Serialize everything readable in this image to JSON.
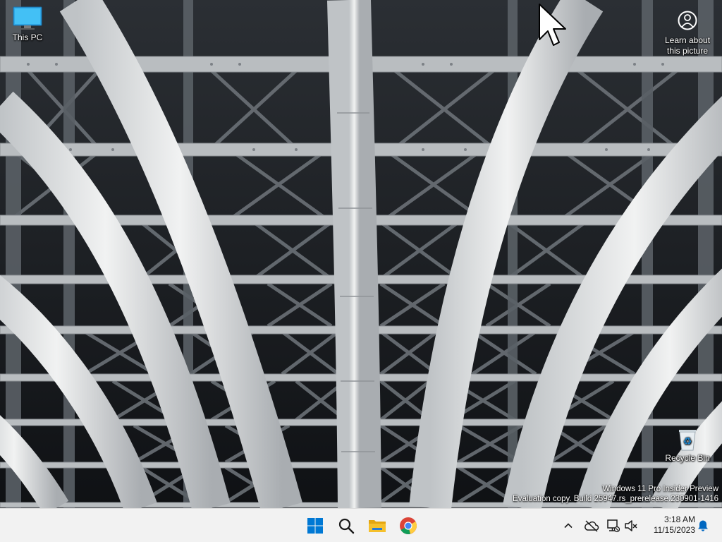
{
  "desktop": {
    "icons": [
      {
        "label": "This PC",
        "icon": "computer-icon"
      },
      {
        "label": "Recycle Bin",
        "icon": "recycle-bin-icon"
      }
    ],
    "learn_about": {
      "line1": "Learn about",
      "line2": "this picture",
      "icon": "camera-info-icon"
    },
    "watermark": {
      "line1": "Windows 11 Pro Insider Preview",
      "line2": "Evaluation copy. Build 25947.rs_prerelease.230901-1416"
    }
  },
  "taskbar": {
    "apps": [
      {
        "name": "Start",
        "icon": "windows-logo-icon"
      },
      {
        "name": "Search",
        "icon": "search-icon"
      },
      {
        "name": "File Explorer",
        "icon": "folder-icon"
      },
      {
        "name": "Google Chrome",
        "icon": "chrome-icon"
      }
    ],
    "tray": {
      "icons": [
        "chevron-up-icon",
        "onedrive-offline-icon",
        "network-disconnected-icon",
        "volume-muted-icon",
        "notification-bell-icon"
      ],
      "time": "3:18 AM",
      "date": "11/15/2023"
    }
  },
  "colors": {
    "taskbar_bg": "#f2f2f2",
    "accent": "#0067c0",
    "start_blue": "#0078d4",
    "folder_yellow": "#f5c02c"
  }
}
